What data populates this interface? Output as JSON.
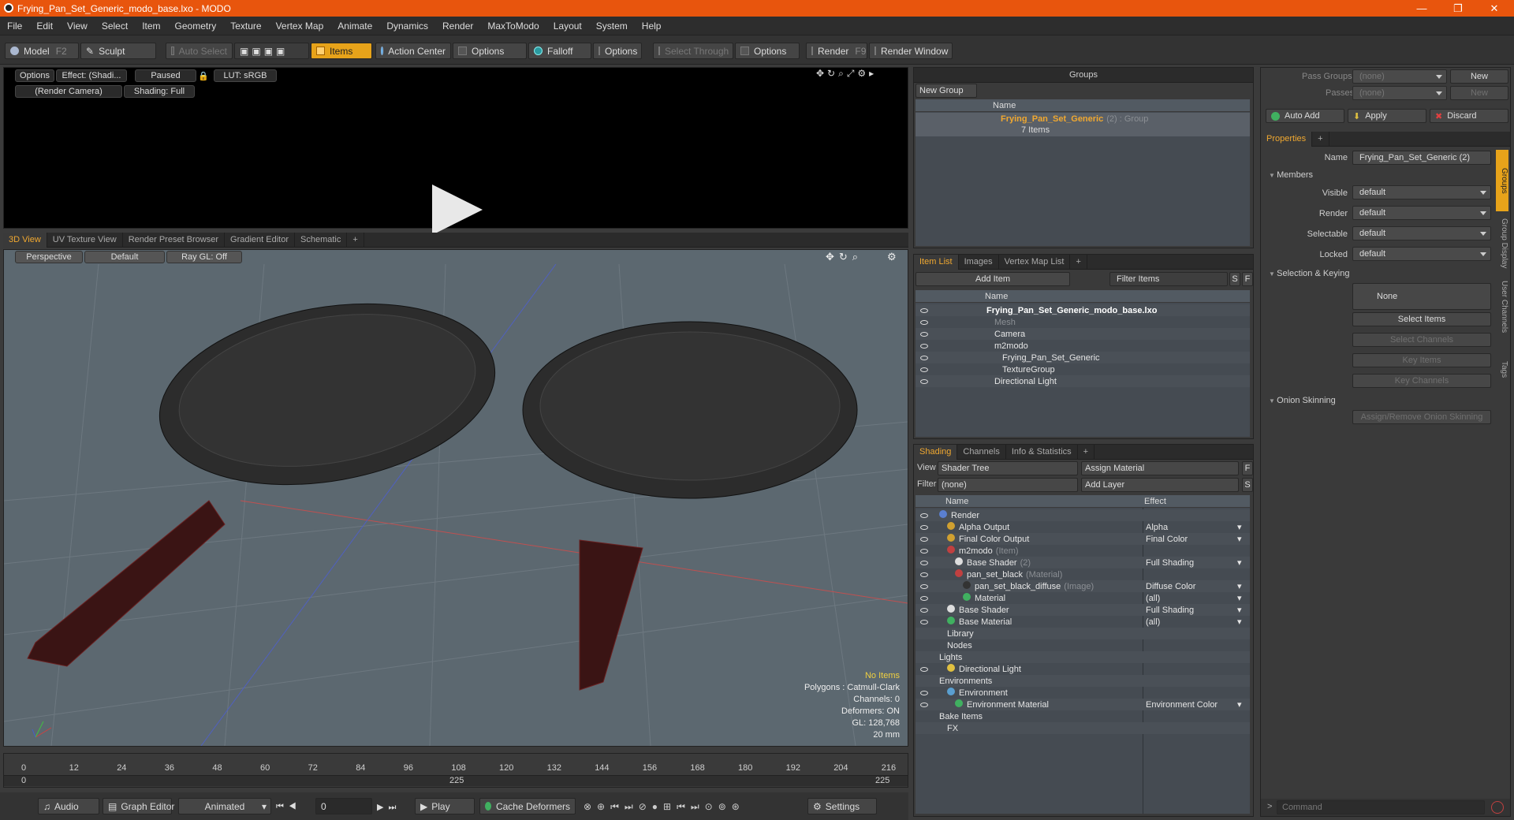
{
  "window": {
    "title": "Frying_Pan_Set_Generic_modo_base.lxo - MODO",
    "min": "—",
    "max": "❐",
    "close": "✕"
  },
  "menu": [
    "File",
    "Edit",
    "View",
    "Select",
    "Item",
    "Geometry",
    "Texture",
    "Vertex Map",
    "Animate",
    "Dynamics",
    "Render",
    "MaxToModo",
    "Layout",
    "System",
    "Help"
  ],
  "toolbar": {
    "model": "Model",
    "model_key": "F2",
    "sculpt": "Sculpt",
    "auto_select": "Auto Select",
    "items": "Items",
    "action_center": "Action Center",
    "options1": "Options",
    "falloff": "Falloff",
    "options2": "Options",
    "select_through": "Select Through",
    "options3": "Options",
    "render": "Render",
    "render_key": "F9",
    "render_window": "Render Window"
  },
  "render_view": {
    "options": "Options",
    "effect": "Effect: (Shadi...",
    "paused": "Paused",
    "lut": "LUT: sRGB",
    "camera": "(Render Camera)",
    "shading": "Shading: Full"
  },
  "view_tabs": [
    "3D View",
    "UV Texture View",
    "Render Preset Browser",
    "Gradient Editor",
    "Schematic",
    "+"
  ],
  "viewport": {
    "perspective": "Perspective",
    "default": "Default",
    "raygl": "Ray GL: Off",
    "info": {
      "no_items": "No Items",
      "polygons": "Polygons : Catmull-Clark",
      "channels": "Channels: 0",
      "deformers": "Deformers: ON",
      "gl": "GL: 128,768",
      "size": "20 mm"
    }
  },
  "timeline": {
    "ticks": [
      "0",
      "12",
      "24",
      "36",
      "48",
      "60",
      "72",
      "84",
      "96",
      "108",
      "120",
      "132",
      "144",
      "156",
      "168",
      "180",
      "192",
      "204",
      "216"
    ],
    "start": "0",
    "mid": "225",
    "end": "225"
  },
  "bottombar": {
    "audio": "Audio",
    "graph": "Graph Editor",
    "animated": "Animated",
    "frame": "0",
    "play": "Play",
    "cache": "Cache Deformers",
    "settings": "Settings"
  },
  "groups": {
    "title": "Groups",
    "new_group": "New Group",
    "col_name": "Name",
    "item": "Frying_Pan_Set_Generic",
    "item_sub": "(2) : Group",
    "item_count": "7 Items"
  },
  "itemlist": {
    "tabs": [
      "Item List",
      "Images",
      "Vertex Map List",
      "+"
    ],
    "add_item": "Add Item",
    "filter": "Filter Items",
    "s": "S",
    "f": "F",
    "col_name": "Name",
    "rows": [
      {
        "label": "Frying_Pan_Set_Generic_modo_base.lxo",
        "indent": 0,
        "style": "bold"
      },
      {
        "label": "Mesh",
        "indent": 1,
        "style": "dim"
      },
      {
        "label": "Camera",
        "indent": 1,
        "style": ""
      },
      {
        "label": "m2modo",
        "indent": 1,
        "style": ""
      },
      {
        "label": "Frying_Pan_Set_Generic",
        "indent": 2,
        "style": ""
      },
      {
        "label": "TextureGroup",
        "indent": 2,
        "style": ""
      },
      {
        "label": "Directional Light",
        "indent": 1,
        "style": ""
      }
    ]
  },
  "shading": {
    "tabs": [
      "Shading",
      "Channels",
      "Info & Statistics",
      "+"
    ],
    "view_label": "View",
    "view": "Shader Tree",
    "assign": "Assign Material",
    "f": "F",
    "filter_label": "Filter",
    "filter": "(none)",
    "add_layer": "Add Layer",
    "s": "S",
    "col_name": "Name",
    "col_effect": "Effect",
    "rows": [
      {
        "label": "Render",
        "sub": "",
        "effect": "",
        "indent": 0,
        "color": "#5a7fd0"
      },
      {
        "label": "Alpha Output",
        "sub": "",
        "effect": "Alpha",
        "indent": 1,
        "color": "#d0a030"
      },
      {
        "label": "Final Color Output",
        "sub": "",
        "effect": "Final Color",
        "indent": 1,
        "color": "#d0a030"
      },
      {
        "label": "m2modo",
        "sub": "(Item)",
        "effect": "",
        "indent": 1,
        "color": "#c04040"
      },
      {
        "label": "Base Shader",
        "sub": "(2)",
        "effect": "Full Shading",
        "indent": 2,
        "color": "#dddddd"
      },
      {
        "label": "pan_set_black",
        "sub": "(Material)",
        "effect": "",
        "indent": 2,
        "color": "#c04040"
      },
      {
        "label": "pan_set_black_diffuse",
        "sub": "(Image)",
        "effect": "Diffuse Color",
        "indent": 3,
        "color": "#333333"
      },
      {
        "label": "Material",
        "sub": "",
        "effect": "(all)",
        "indent": 3,
        "color": "#40b060"
      },
      {
        "label": "Base Shader",
        "sub": "",
        "effect": "Full Shading",
        "indent": 1,
        "color": "#dddddd"
      },
      {
        "label": "Base Material",
        "sub": "",
        "effect": "(all)",
        "indent": 1,
        "color": "#40b060"
      },
      {
        "label": "Library",
        "sub": "",
        "effect": "",
        "indent": 1,
        "color": ""
      },
      {
        "label": "Nodes",
        "sub": "",
        "effect": "",
        "indent": 1,
        "color": ""
      },
      {
        "label": "Lights",
        "sub": "",
        "effect": "",
        "indent": 0,
        "color": ""
      },
      {
        "label": "Directional Light",
        "sub": "",
        "effect": "",
        "indent": 1,
        "color": "#e0c040"
      },
      {
        "label": "Environments",
        "sub": "",
        "effect": "",
        "indent": 0,
        "color": ""
      },
      {
        "label": "Environment",
        "sub": "",
        "effect": "",
        "indent": 1,
        "color": "#5a9fd0"
      },
      {
        "label": "Environment Material",
        "sub": "",
        "effect": "Environment Color",
        "indent": 2,
        "color": "#40b060"
      },
      {
        "label": "Bake Items",
        "sub": "",
        "effect": "",
        "indent": 0,
        "color": ""
      },
      {
        "label": "FX",
        "sub": "",
        "effect": "",
        "indent": 1,
        "color": ""
      }
    ]
  },
  "props": {
    "pass_groups": "Pass Groups",
    "passes": "Passes",
    "none": "(none)",
    "new": "New",
    "auto_add": "Auto Add",
    "apply": "Apply",
    "discard": "Discard",
    "tab": "Properties",
    "plus": "+",
    "name_label": "Name",
    "name": "Frying_Pan_Set_Generic (2)",
    "members": "Members",
    "visible": "Visible",
    "render": "Render",
    "selectable": "Selectable",
    "locked": "Locked",
    "default": "default",
    "sel_key": "Selection & Keying",
    "none_btn": "None",
    "select_items": "Select Items",
    "select_channels": "Select Channels",
    "key_items": "Key Items",
    "key_channels": "Key Channels",
    "onion": "Onion Skinning",
    "assign_onion": "Assign/Remove Onion Skinning",
    "side_tabs": [
      "Groups",
      "Group Display",
      "User Channels",
      "Tags"
    ],
    "command": "Command"
  }
}
